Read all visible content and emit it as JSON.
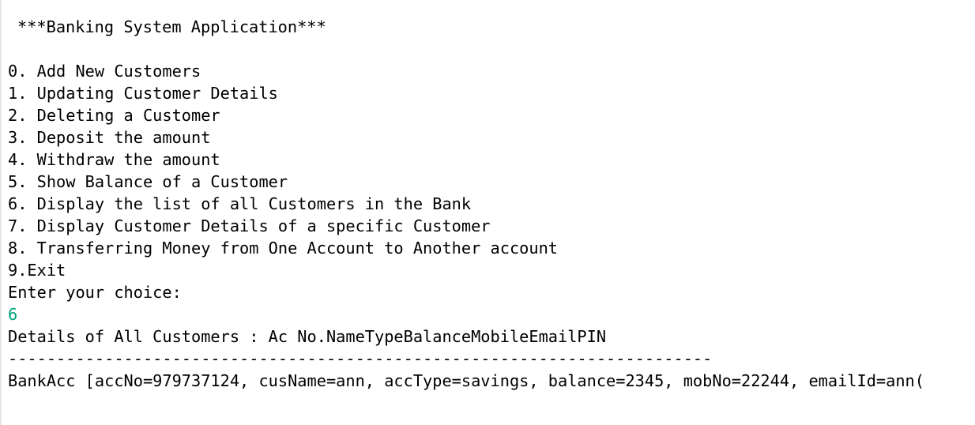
{
  "console": {
    "title": "***Banking System Application***",
    "menu": [
      "0. Add New Customers",
      "1. Updating Customer Details",
      "2. Deleting a Customer",
      "3. Deposit the amount",
      "4. Withdraw the amount",
      "5. Show Balance of a Customer",
      "6. Display the list of all Customers in the Bank",
      "7. Display Customer Details of a specific Customer",
      "8. Transferring Money from One Account to Another account",
      "9.Exit"
    ],
    "prompt": "Enter your choice:",
    "user_input": "6",
    "details_header": "Details of All Customers : Ac No.NameTypeBalanceMobileEmailPIN",
    "separator": "-------------------------------------------------------------------------",
    "record": "BankAcc [accNo=979737124, cusName=ann, accType=savings, balance=2345, mobNo=22244, emailId=ann("
  },
  "colors": {
    "background": "#ffffff",
    "text": "#000000",
    "user_input": "#00a37a"
  }
}
